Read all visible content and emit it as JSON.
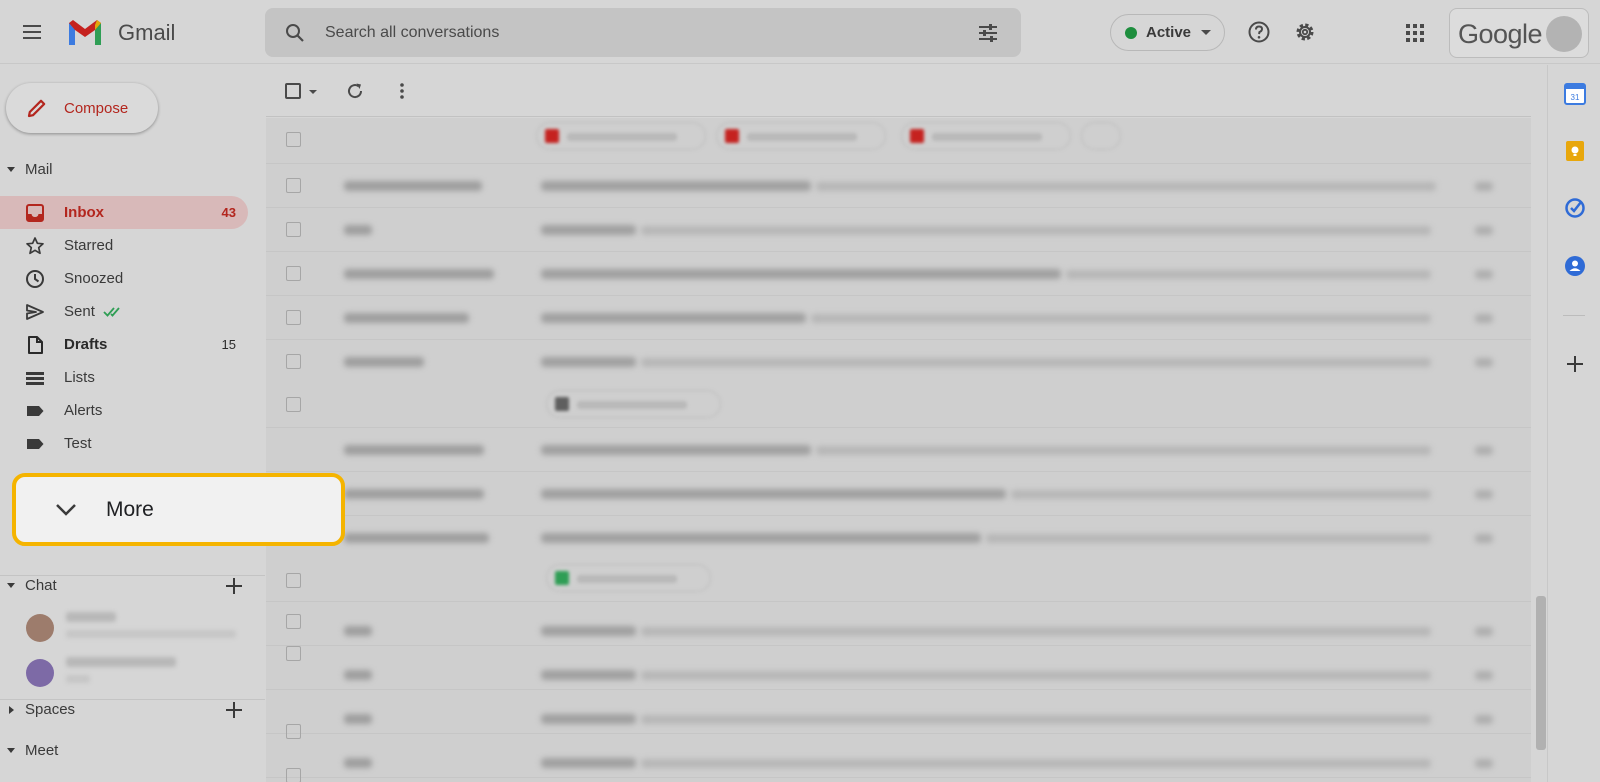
{
  "app": {
    "name": "Gmail"
  },
  "search": {
    "placeholder": "Search all conversations"
  },
  "header": {
    "status_label": "Active",
    "account_label": "Google"
  },
  "compose": {
    "label": "Compose"
  },
  "sidebar": {
    "mail_section": "Mail",
    "items": [
      {
        "label": "Inbox",
        "count": "43",
        "icon": "inbox-icon"
      },
      {
        "label": "Starred",
        "count": "",
        "icon": "star-icon"
      },
      {
        "label": "Snoozed",
        "count": "",
        "icon": "clock-icon"
      },
      {
        "label": "Sent",
        "count": "",
        "icon": "send-icon"
      },
      {
        "label": "Drafts",
        "count": "15",
        "icon": "draft-icon"
      },
      {
        "label": "Lists",
        "count": "",
        "icon": "list-icon"
      },
      {
        "label": "Alerts",
        "count": "",
        "icon": "label-icon"
      },
      {
        "label": "Test",
        "count": "",
        "icon": "label-icon"
      }
    ],
    "more_label": "More",
    "chat_section": "Chat",
    "spaces_section": "Spaces",
    "meet_section": "Meet"
  },
  "colors": {
    "accent": "#b3261e",
    "highlight": "#f5b400",
    "status": "#1e8e3e"
  }
}
